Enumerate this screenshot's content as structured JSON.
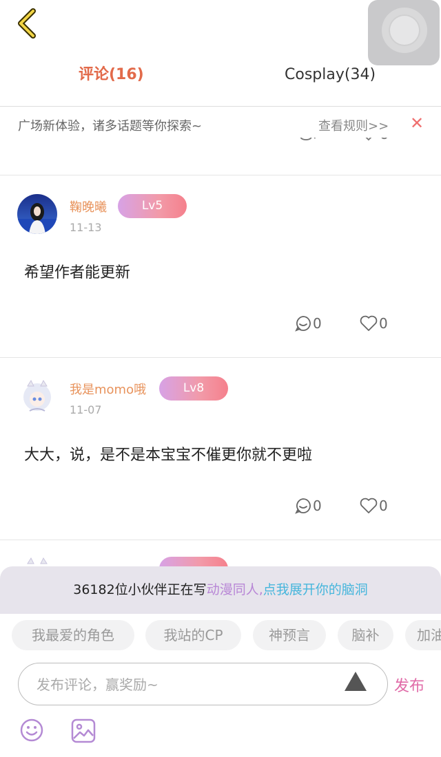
{
  "tabs": {
    "comments": "评论(16)",
    "cosplay": "Cosplay(34)"
  },
  "notice": {
    "text": "广场新体验，诸多话题等你探索~",
    "rules_link": "查看规则>>",
    "close": "✕"
  },
  "comments": [
    {
      "username": "鞠晚曦",
      "level": "Lv5",
      "date": "11-13",
      "text": "希望作者能更新",
      "reply_count": "0",
      "like_count": "0"
    },
    {
      "username": "我是momo哦",
      "level": "Lv8",
      "date": "11-07",
      "text": "大大，说，是不是本宝宝不催更你就不更啦",
      "reply_count": "0",
      "like_count": "0"
    }
  ],
  "composer": {
    "promo_count": "36182位小伙伴正在写",
    "promo_highlight": "动漫同人,",
    "promo_cta": "点我展开你的脑洞",
    "topics": [
      "我最爱的角色",
      "我站的CP",
      "神预言",
      "脑补",
      "加油"
    ],
    "placeholder": "发布评论，赢奖励~",
    "publish_label": "发布"
  },
  "colors": {
    "accent_tab": "#e26a4a",
    "username": "#e8935c",
    "publish": "#e06aa7",
    "promo_highlight": "#b886d6",
    "promo_cta": "#47b6dc"
  }
}
